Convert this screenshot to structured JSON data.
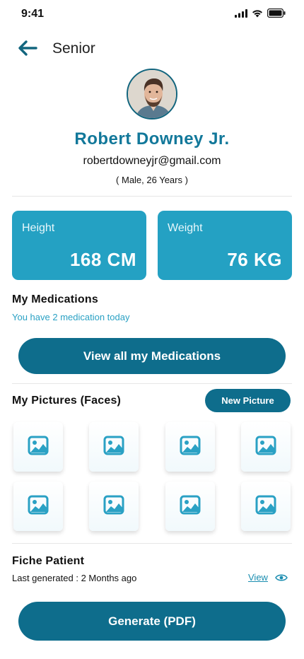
{
  "status": {
    "time": "9:41"
  },
  "header": {
    "title": "Senior"
  },
  "profile": {
    "name": "Robert Downey Jr.",
    "email": "robertdowneyjr@gmail.com",
    "meta": "( Male, 26 Years )"
  },
  "metrics": [
    {
      "label": "Height",
      "value": "168 CM"
    },
    {
      "label": "Weight",
      "value": "76 KG"
    }
  ],
  "medications": {
    "title": "My Medications",
    "subtitle": "You have 2 medication today",
    "button_label": "View all my Medications"
  },
  "pictures": {
    "title": "My Pictures (Faces)",
    "new_button_label": "New Picture",
    "tiles": 8,
    "icon": "image-icon"
  },
  "fiche": {
    "title": "Fiche Patient",
    "subtitle": "Last generated : 2 Months ago",
    "view_label": "View",
    "generate_label": "Generate (PDF)"
  },
  "colors": {
    "accent": "#0e6d8c",
    "card": "#24a1c3",
    "name": "#12789a",
    "link": "#2aa1c4"
  }
}
